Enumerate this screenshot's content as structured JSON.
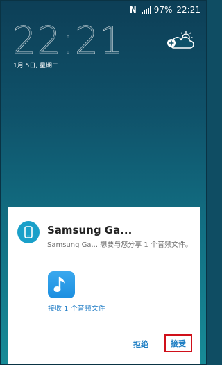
{
  "status_bar": {
    "nfc_label": "N",
    "battery": "97%",
    "time": "22:21"
  },
  "lockscreen": {
    "clock": "22:21",
    "date": "1月 5日, 星期二",
    "weather_icon": "cloud-sun-add-icon"
  },
  "dialog": {
    "title": "Samsung Ga...",
    "message": "Samsung Ga... 想要与您分享 1 个音频文件。",
    "file_icon": "music-note-icon",
    "file_label": "接收 1 个音频文件",
    "decline_label": "拒绝",
    "accept_label": "接受"
  },
  "colors": {
    "accent": "#1f7fc4",
    "highlight_border": "#d0101a",
    "app_icon": "#1aa0c9"
  }
}
